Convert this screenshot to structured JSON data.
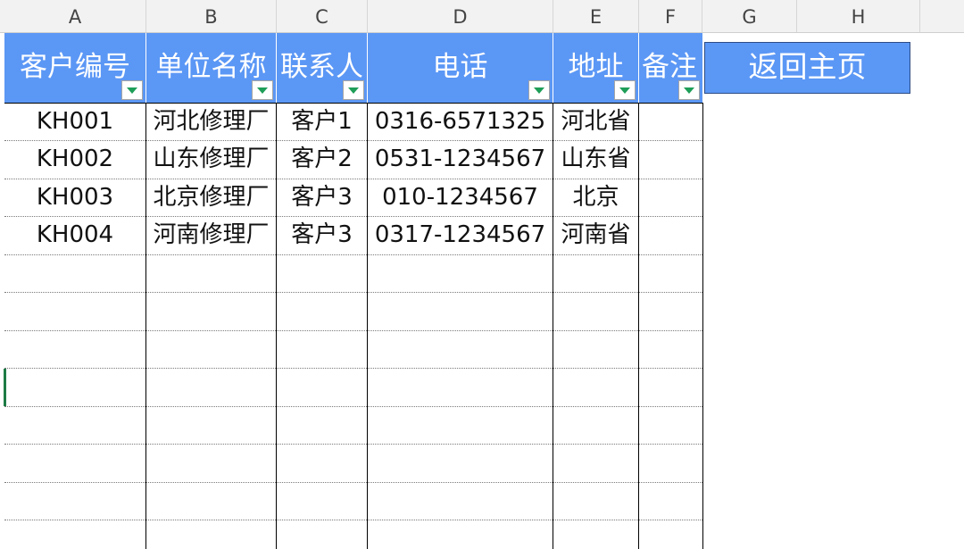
{
  "sheet": {
    "column_letters": [
      "A",
      "B",
      "C",
      "D",
      "E",
      "F",
      "G",
      "H"
    ],
    "headers": [
      "客户编号",
      "单位名称",
      "联系人",
      "电话",
      "地址",
      "备注"
    ],
    "rows": [
      [
        "KH001",
        "河北修理厂",
        "客户1",
        "0316-6571325",
        "河北省",
        ""
      ],
      [
        "KH002",
        "山东修理厂",
        "客户2",
        "0531-1234567",
        "山东省",
        ""
      ],
      [
        "KH003",
        "北京修理厂",
        "客户3",
        "010-1234567",
        "北京",
        ""
      ],
      [
        "KH004",
        "河南修理厂",
        "客户3",
        "0317-1234567",
        "河南省",
        ""
      ]
    ],
    "filter_icon": "dropdown-filter-icon",
    "header_color": "#5b97f5",
    "filter_arrow_color": "#1e9e58"
  },
  "home_button": {
    "label": "返回主页"
  }
}
